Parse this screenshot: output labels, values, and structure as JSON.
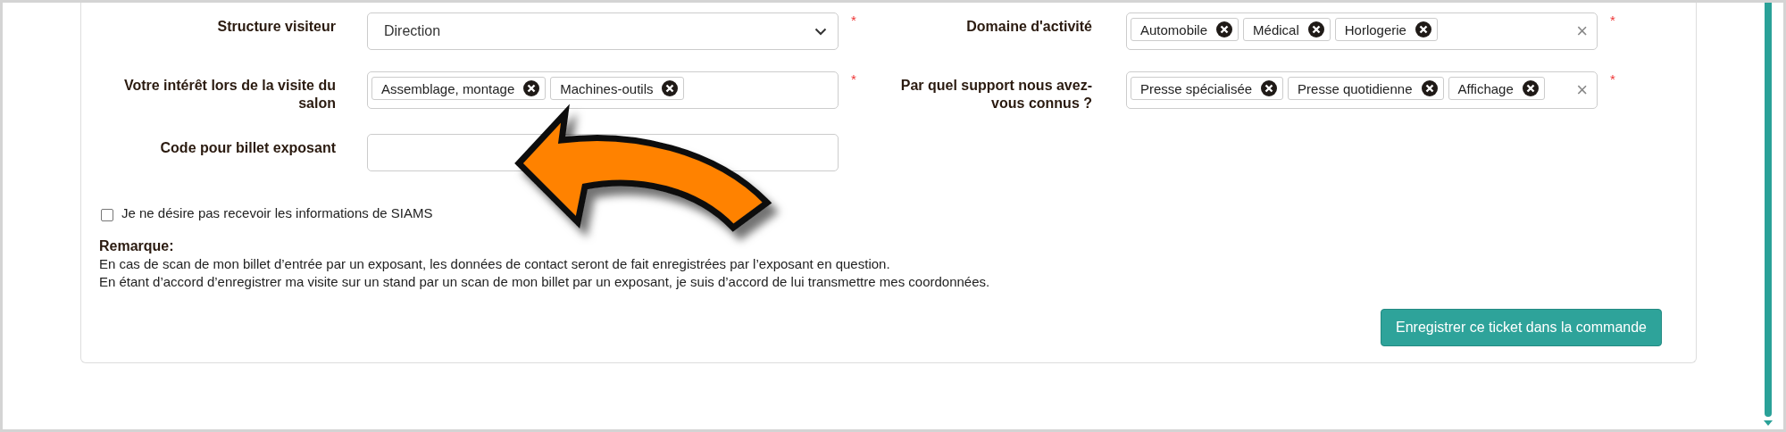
{
  "fields": [
    {
      "label": "Structure visiteur",
      "kind": "select",
      "value": "Direction",
      "required_mark": "*"
    },
    {
      "label": "Domaine d'activité",
      "kind": "tags",
      "tags": [
        "Automobile",
        "Médical",
        "Horlogerie"
      ],
      "clear": "×",
      "required_mark": "*"
    },
    {
      "label": "Votre intérêt lors de la visite du salon",
      "kind": "tags",
      "tags": [
        "Assemblage, montage",
        "Machines-outils"
      ],
      "required_mark": "*"
    },
    {
      "label": "Par quel support nous avez-vous connus ?",
      "kind": "tags",
      "tags": [
        "Presse spécialisée",
        "Presse quotidienne",
        "Affichage"
      ],
      "clear": "×",
      "required_mark": "*"
    },
    {
      "label": "Code pour billet exposant",
      "kind": "text"
    }
  ],
  "newsletter": {
    "label": "Je ne désire pas recevoir les informations de SIAMS",
    "checked": false
  },
  "remark": {
    "title": "Remarque:",
    "lines": [
      "En cas de scan de mon billet d’entrée par un exposant, les données de contact seront de fait enregistrées par l’exposant en question.",
      "En étant d’accord d’enregistrer ma visite sur un stand par un scan de mon billet par un exposant, je suis d’accord de lui transmettre mes coordonnées."
    ]
  },
  "submit": "Enregistrer ce ticket dans la commande"
}
